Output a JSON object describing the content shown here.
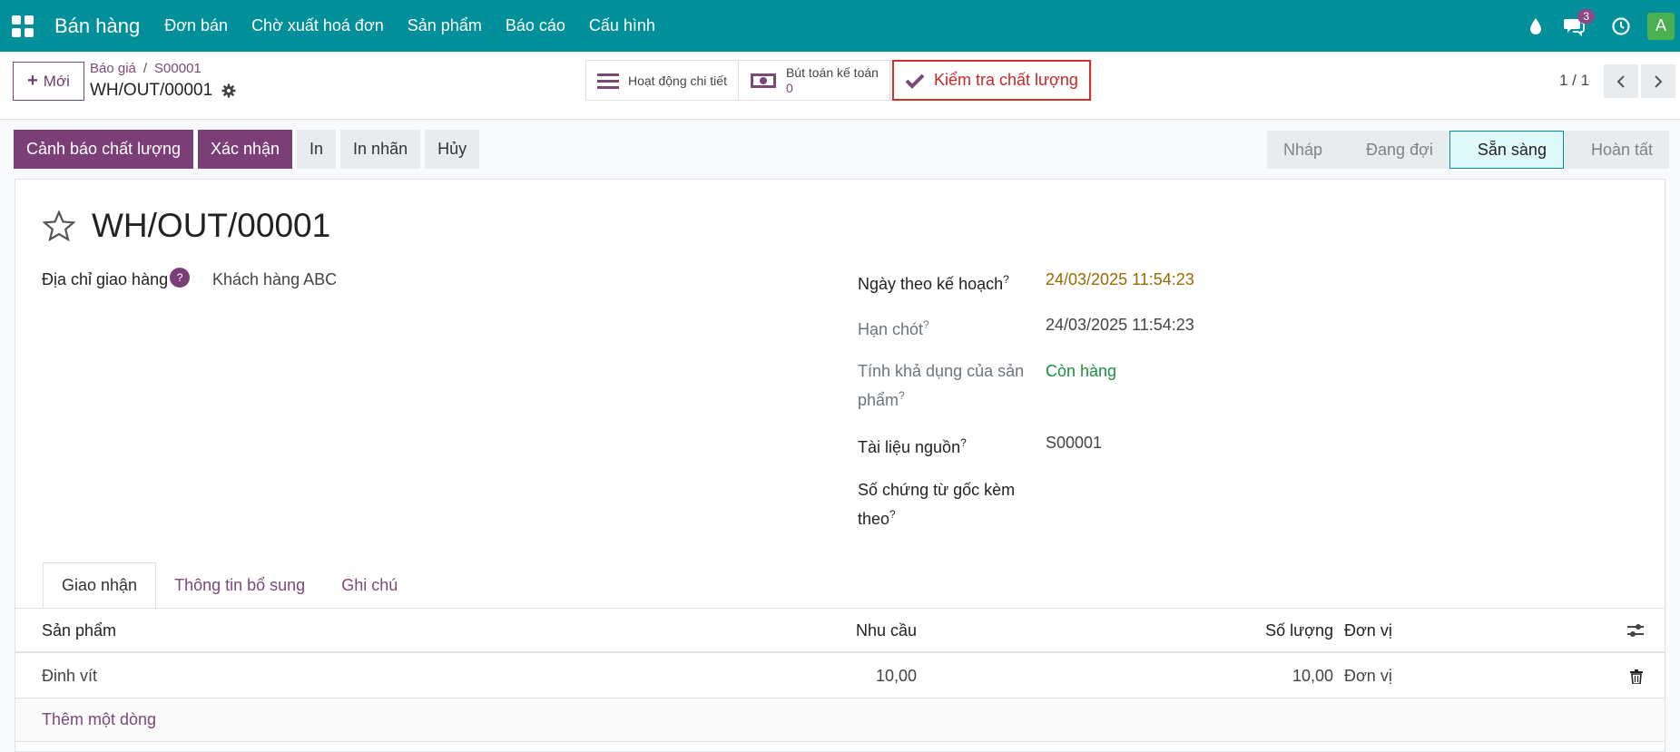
{
  "navbar": {
    "brand": "Bán hàng",
    "menu": [
      "Đơn bán",
      "Chờ xuất hoá đơn",
      "Sản phẩm",
      "Báo cáo",
      "Cấu hình"
    ],
    "chat_count": "3",
    "avatar_letter": "A"
  },
  "control": {
    "new_label": "Mới",
    "breadcrumb": [
      "Báo giá",
      "S00001"
    ],
    "record_name": "WH/OUT/00001",
    "smart_buttons": {
      "moves_label": "Hoạt động chi tiết",
      "accounting_label": "Bút toán kế toán",
      "accounting_value": "0",
      "quality_label": "Kiểm tra chất lượng"
    },
    "pager": "1 / 1"
  },
  "actions": {
    "quality_alert": "Cảnh báo chất lượng",
    "validate": "Xác nhận",
    "print": "In",
    "print_labels": "In nhãn",
    "cancel": "Hủy"
  },
  "stages": [
    "Nháp",
    "Đang đợi",
    "Sẵn sàng",
    "Hoàn tất"
  ],
  "form": {
    "title": "WH/OUT/00001",
    "delivery_address_label": "Địa chỉ giao hàng",
    "delivery_address_value": "Khách hàng ABC",
    "scheduled_label": "Ngày theo kế hoạch",
    "scheduled_value": "24/03/2025 11:54:23",
    "deadline_label": "Hạn chót",
    "deadline_value": "24/03/2025 11:54:23",
    "availability_label_1": "Tính khả dụng của sản",
    "availability_label_2": "phẩm",
    "availability_value": "Còn hàng",
    "source_label": "Tài liệu nguồn",
    "source_value": "S00001",
    "origin_label_1": "Số chứng từ gốc kèm",
    "origin_label_2": "theo",
    "help_mark": "?"
  },
  "tabs": [
    "Giao nhận",
    "Thông tin bổ sung",
    "Ghi chú"
  ],
  "table": {
    "headers": {
      "product": "Sản phẩm",
      "demand": "Nhu cầu",
      "quantity": "Số lượng",
      "uom": "Đơn vị"
    },
    "rows": [
      {
        "product": "Đinh vít",
        "demand": "10,00",
        "quantity": "10,00",
        "uom": "Đơn vị"
      }
    ],
    "add_line": "Thêm một dòng"
  },
  "colors": {
    "navbar": "#018f99",
    "primary": "#7b3f77",
    "warning_date": "#9a6a00",
    "success": "#1e8e3e",
    "danger": "#c62828"
  }
}
